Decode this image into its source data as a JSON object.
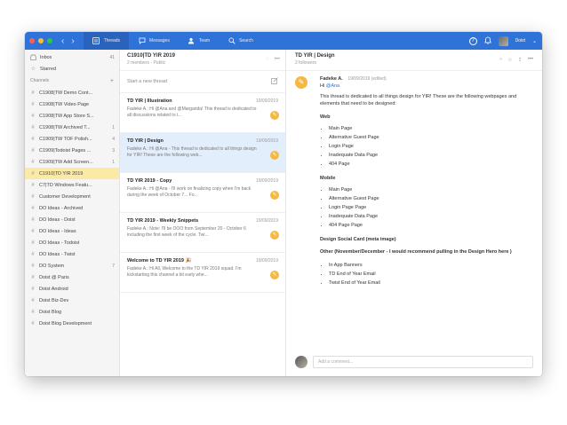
{
  "topbar": {
    "tabs": [
      {
        "label": "Threads",
        "icon": "threads-icon",
        "active": true
      },
      {
        "label": "Messages",
        "icon": "messages-icon",
        "active": false
      },
      {
        "label": "Team",
        "icon": "team-icon",
        "active": false
      },
      {
        "label": "Search",
        "icon": "search-icon",
        "active": false
      }
    ],
    "user_label": "Doist",
    "colors": {
      "bar": "#2f72d8",
      "red": "#fc5f57",
      "yellow": "#fdbc2e",
      "green": "#28c840"
    }
  },
  "sidebar": {
    "inbox": {
      "label": "Inbox",
      "count": "41"
    },
    "starred": {
      "label": "Starred"
    },
    "channels_label": "Channels",
    "channels": [
      {
        "name": "C1908|TW Demo Cont...",
        "count": ""
      },
      {
        "name": "C1908|TW Video Page",
        "count": ""
      },
      {
        "name": "C1908|TW App Store S...",
        "count": ""
      },
      {
        "name": "C1908|TW Archived T...",
        "count": "1"
      },
      {
        "name": "C1909|TW TOF Polish...",
        "count": "4"
      },
      {
        "name": "C1909|Todoist Pages ...",
        "count": "3"
      },
      {
        "name": "C1909|TW Add Screen...",
        "count": "1"
      },
      {
        "name": "C1910|TD YIR 2019",
        "count": "",
        "selected": true
      },
      {
        "name": "C7|TD Windows Featu...",
        "count": ""
      },
      {
        "name": "Customer Development",
        "count": ""
      },
      {
        "name": "DO Ideas - Archived",
        "count": ""
      },
      {
        "name": "DO Ideas - Doist",
        "count": ""
      },
      {
        "name": "DO Ideas - Ideas",
        "count": ""
      },
      {
        "name": "DO Ideas - Todoist",
        "count": ""
      },
      {
        "name": "DO Ideas - Twist",
        "count": ""
      },
      {
        "name": "DO System",
        "count": "7"
      },
      {
        "name": "Doist @ Paris",
        "count": ""
      },
      {
        "name": "Doist Android",
        "count": ""
      },
      {
        "name": "Doist Biz-Dev",
        "count": ""
      },
      {
        "name": "Doist Blog",
        "count": ""
      },
      {
        "name": "Doist Blog Development",
        "count": ""
      }
    ]
  },
  "threadlist": {
    "title": "C1910|TD YIR 2019",
    "subtitle": "2 members · Public",
    "start_label": "Start a new thread",
    "threads": [
      {
        "title": "TD YIR | Illustration",
        "date": "19/09/2019",
        "snippet": "Fadeke A.: Hi @Ana and @Margarida! This thread is dedicated to all discussions related to i..."
      },
      {
        "title": "TD YIR | Design",
        "date": "19/09/2019",
        "snippet": "Fadeke A.: Hi @Ana - This thread is dedicated to all things design for YIR! These are the following web...",
        "active": true
      },
      {
        "title": "TD YIR 2019 - Copy",
        "date": "19/09/2019",
        "snippet": "Fadeke A.: Hi @Ana - I'll work on finalizing copy when I'm back during the week of October 7... Fo..."
      },
      {
        "title": "TD YIR 2019 - Weekly Snippets",
        "date": "19/09/2019",
        "snippet": "Fadeke A.: Note: I'll be OOO from September 20 - October 6 including the first week of the cycle. Twi..."
      },
      {
        "title": "Welcome to TD YIR 2019 🎉",
        "date": "19/09/2019",
        "snippet": "Fadeke A.: Hi All, Welcome to the TD YIR 2019 squad. I'm kickstarting this channel a bit early whe..."
      }
    ]
  },
  "content": {
    "title": "TD YIR | Design",
    "subtitle": "2 followers",
    "message": {
      "author": "Fadeke A.",
      "time": "19/09/2019 (edited)",
      "greeting_prefix": "Hi ",
      "mention": "@Ana",
      "intro": "This thread is dedicated to all things design for YIR! These are the following webpages and elements that need to be designed:",
      "web_label": "Web",
      "web_items": [
        "Main Page",
        "Alternative Guest Page",
        "Login Page",
        "Inadequate Data Page",
        "404 Page"
      ],
      "mobile_label": "Mobile",
      "mobile_items": [
        "Main Page",
        "Alternative Guest Page",
        "Login Page Page",
        "Inadequate Data Page",
        "404 Page Page"
      ],
      "social_label": "Design Social Card (meta image)",
      "other_label": "Other (November/December - I would recommend pulling in the Design Hero here )",
      "other_items": [
        "In App Banners",
        "TD End of Year Email",
        "Twist End of Year Email"
      ]
    },
    "comment_placeholder": "Add a comment..."
  }
}
